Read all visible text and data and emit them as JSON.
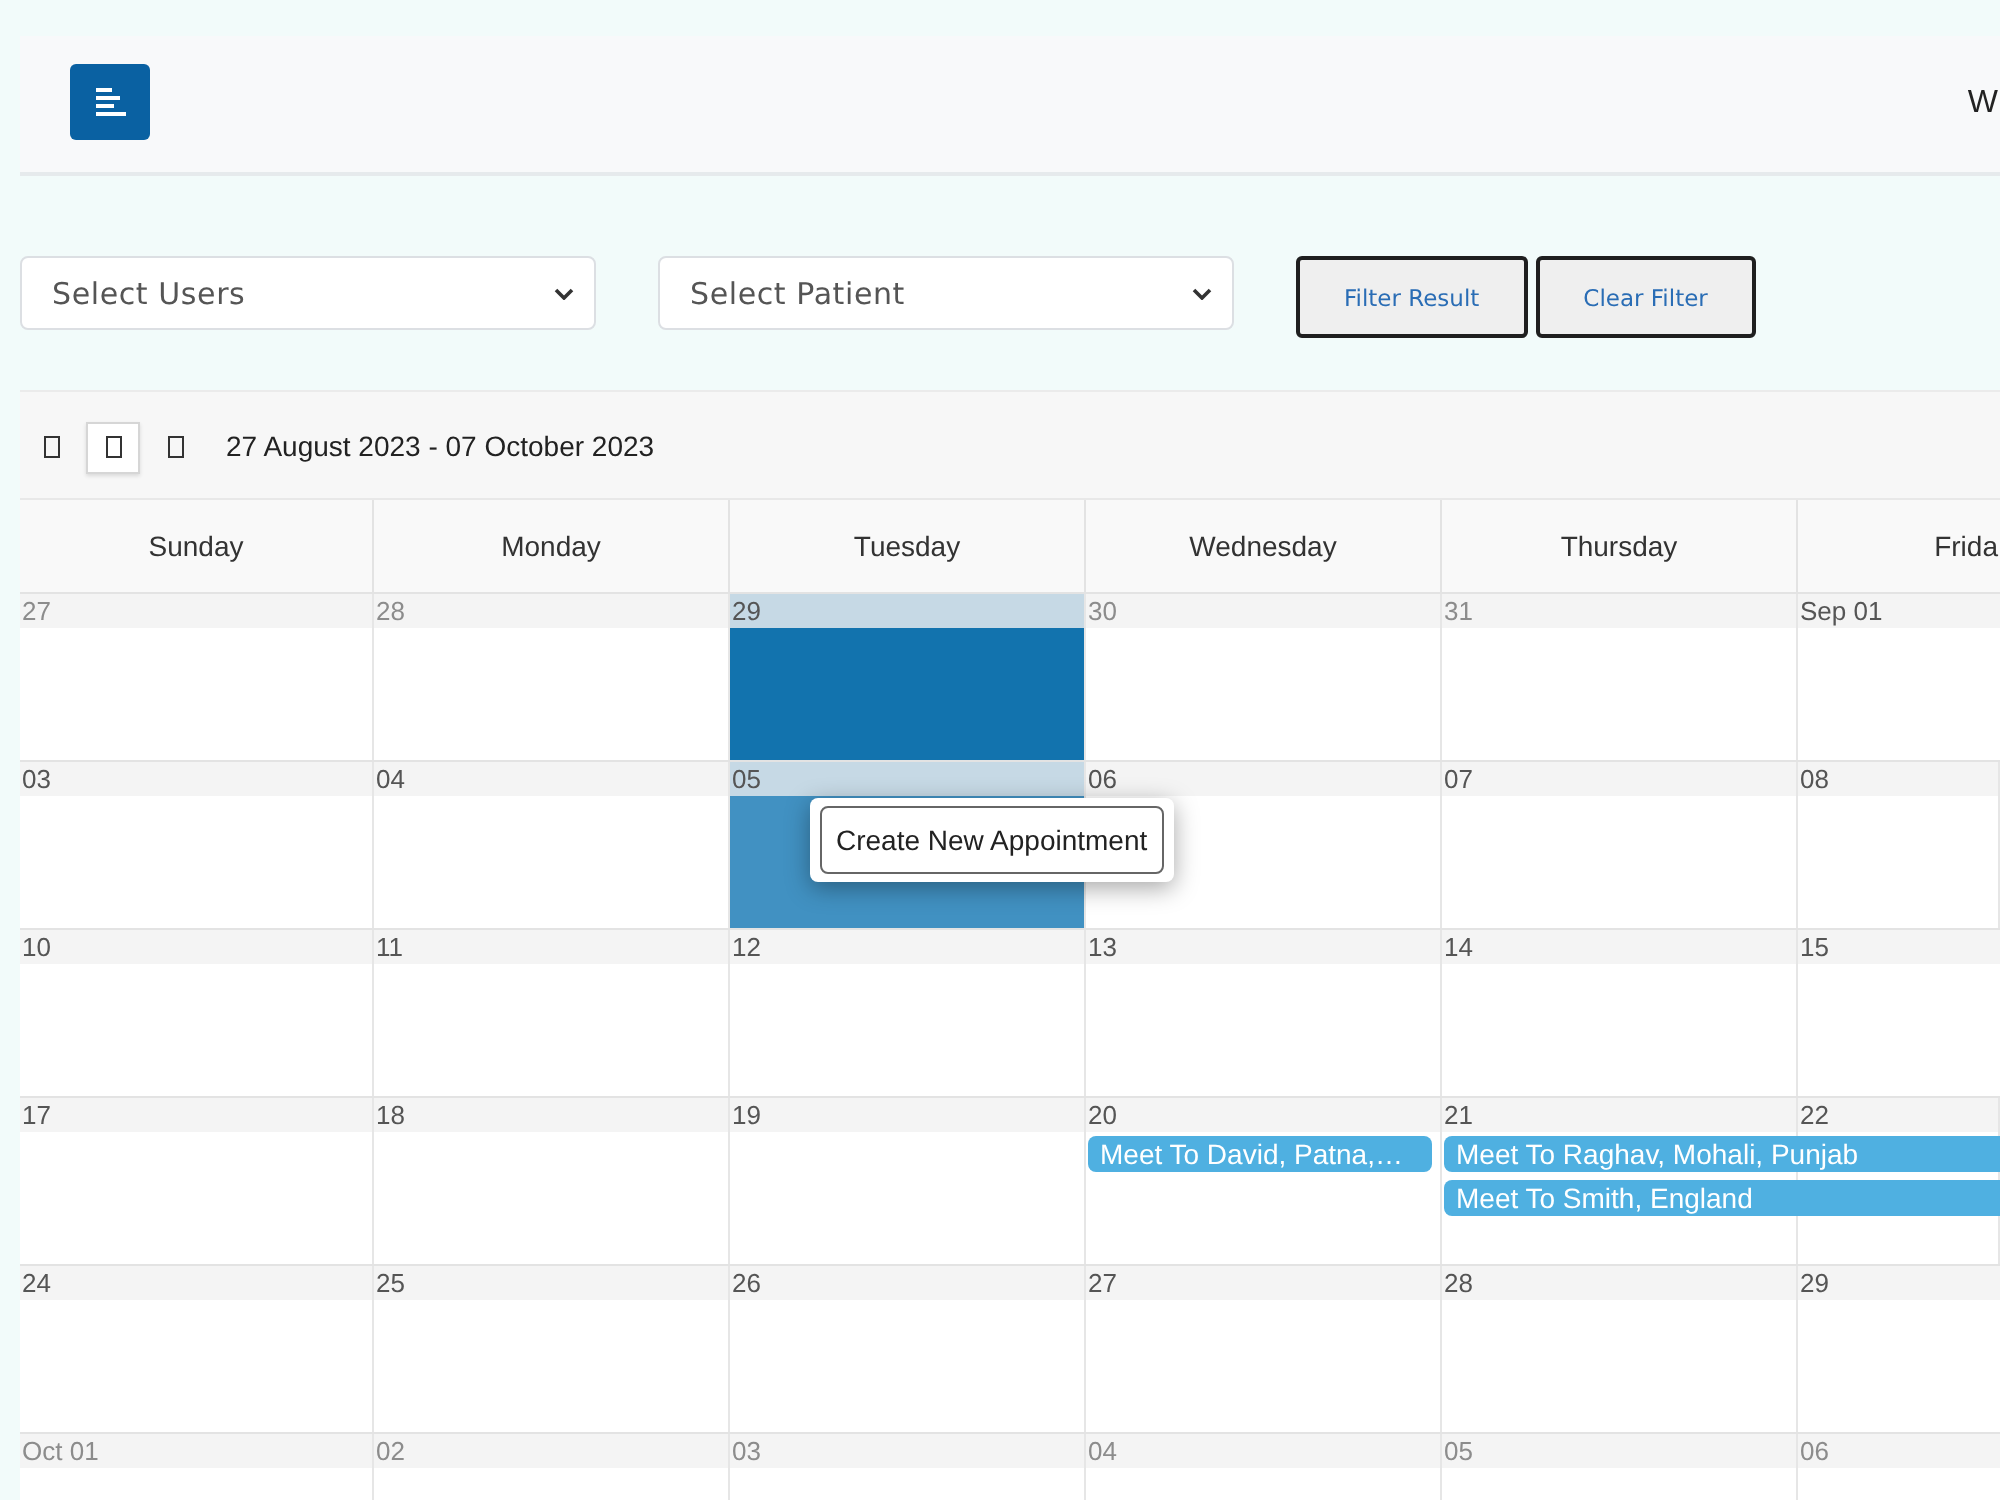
{
  "header": {
    "user_label": "W"
  },
  "filters": {
    "selects": [
      {
        "value": "Select Users"
      },
      {
        "value": "Select Patient"
      }
    ],
    "buttons": [
      "Filter Result",
      "Clear Filter"
    ]
  },
  "calendar": {
    "nav_buttons": [
      {
        "selected": false
      },
      {
        "selected": true
      },
      {
        "selected": false
      }
    ],
    "range_title": "27 August 2023 - 07 October 2023",
    "weekdays": [
      "Sunday",
      "Monday",
      "Tuesday",
      "Wednesday",
      "Thursday",
      "Frida"
    ],
    "weeks": [
      {
        "days": [
          {
            "date": "27",
            "other_month": true,
            "selected": false,
            "hovered": false
          },
          {
            "date": "28",
            "other_month": true,
            "selected": false,
            "hovered": false
          },
          {
            "date": "29",
            "other_month": true,
            "selected": true,
            "hovered": false
          },
          {
            "date": "30",
            "other_month": true,
            "selected": false,
            "hovered": false
          },
          {
            "date": "31",
            "other_month": true,
            "selected": false,
            "hovered": false
          },
          {
            "date": "Sep 01",
            "other_month": false,
            "selected": false,
            "hovered": false
          }
        ]
      },
      {
        "days": [
          {
            "date": "03",
            "other_month": false,
            "selected": false,
            "hovered": false
          },
          {
            "date": "04",
            "other_month": false,
            "selected": false,
            "hovered": false
          },
          {
            "date": "05",
            "other_month": false,
            "selected": false,
            "hovered": true,
            "popup": "Create New Appointment"
          },
          {
            "date": "06",
            "other_month": false,
            "selected": false,
            "hovered": false
          },
          {
            "date": "07",
            "other_month": false,
            "selected": false,
            "hovered": false
          },
          {
            "date": "08",
            "other_month": false,
            "selected": false,
            "hovered": false
          }
        ]
      },
      {
        "days": [
          {
            "date": "10",
            "other_month": false,
            "selected": false,
            "hovered": false
          },
          {
            "date": "11",
            "other_month": false,
            "selected": false,
            "hovered": false
          },
          {
            "date": "12",
            "other_month": false,
            "selected": false,
            "hovered": false
          },
          {
            "date": "13",
            "other_month": false,
            "selected": false,
            "hovered": false
          },
          {
            "date": "14",
            "other_month": false,
            "selected": false,
            "hovered": false
          },
          {
            "date": "15",
            "other_month": false,
            "selected": false,
            "hovered": false
          }
        ]
      },
      {
        "days": [
          {
            "date": "17",
            "other_month": false,
            "selected": false,
            "hovered": false
          },
          {
            "date": "18",
            "other_month": false,
            "selected": false,
            "hovered": false
          },
          {
            "date": "19",
            "other_month": false,
            "selected": false,
            "hovered": false
          },
          {
            "date": "20",
            "other_month": false,
            "selected": false,
            "hovered": false,
            "events": [
              {
                "title": "Meet To David, Patna,…",
                "continues": false
              }
            ]
          },
          {
            "date": "21",
            "other_month": false,
            "selected": false,
            "hovered": false,
            "events": [
              {
                "title": "Meet To Raghav, Mohali, Punjab",
                "continues": true
              },
              {
                "title": "Meet To Smith, England",
                "continues": true
              }
            ]
          },
          {
            "date": "22",
            "other_month": false,
            "selected": false,
            "hovered": false
          }
        ]
      },
      {
        "days": [
          {
            "date": "24",
            "other_month": false,
            "selected": false,
            "hovered": false
          },
          {
            "date": "25",
            "other_month": false,
            "selected": false,
            "hovered": false
          },
          {
            "date": "26",
            "other_month": false,
            "selected": false,
            "hovered": false
          },
          {
            "date": "27",
            "other_month": false,
            "selected": false,
            "hovered": false
          },
          {
            "date": "28",
            "other_month": false,
            "selected": false,
            "hovered": false
          },
          {
            "date": "29",
            "other_month": false,
            "selected": false,
            "hovered": false
          }
        ]
      },
      {
        "days": [
          {
            "date": "Oct 01",
            "other_month": true,
            "selected": false,
            "hovered": false
          },
          {
            "date": "02",
            "other_month": true,
            "selected": false,
            "hovered": false
          },
          {
            "date": "03",
            "other_month": true,
            "selected": false,
            "hovered": false
          },
          {
            "date": "04",
            "other_month": true,
            "selected": false,
            "hovered": false
          },
          {
            "date": "05",
            "other_month": true,
            "selected": false,
            "hovered": false
          },
          {
            "date": "06",
            "other_month": true,
            "selected": false,
            "hovered": false
          }
        ]
      }
    ]
  }
}
